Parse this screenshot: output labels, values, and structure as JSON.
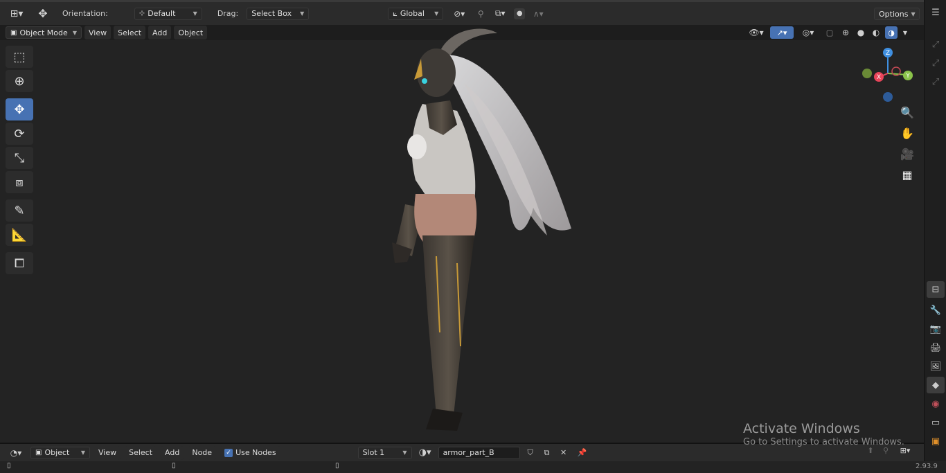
{
  "tool_header": {
    "orientation_label": "Orientation:",
    "orientation_value": "Default",
    "drag_label": "Drag:",
    "drag_value": "Select Box",
    "transform_orientation": "Global",
    "options_label": "Options"
  },
  "view_header": {
    "mode": "Object Mode",
    "menu": [
      "View",
      "Select",
      "Add",
      "Object"
    ]
  },
  "gizmo": {
    "x_label": "X",
    "y_label": "Y",
    "z_label": "Z",
    "x_color": "#e8455a",
    "y_color": "#8bc34a",
    "z_color": "#3f8fe0"
  },
  "shader_header": {
    "editor_type": "Object",
    "menu": [
      "View",
      "Select",
      "Add",
      "Node"
    ],
    "use_nodes_label": "Use Nodes",
    "use_nodes_checked": true,
    "slot": "Slot 1",
    "material": "armor_part_B"
  },
  "status_bar": {
    "version": "2.93.9"
  },
  "watermark": {
    "title": "Activate Windows",
    "subtitle": "Go to Settings to activate Windows."
  },
  "colors": {
    "accent": "#4772b3",
    "background": "#232323"
  }
}
